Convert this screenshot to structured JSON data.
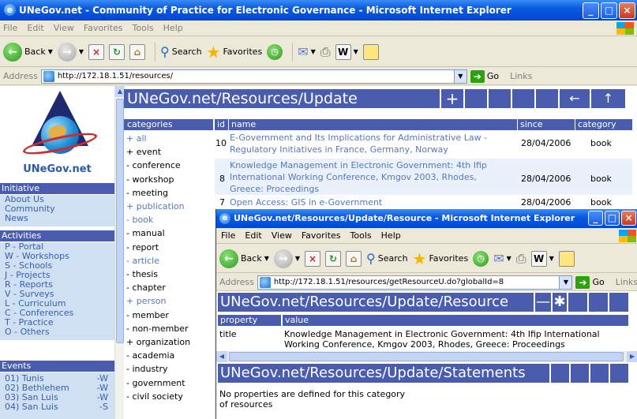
{
  "main_window": {
    "title": "UNeGov.net - Community of Practice for Electronic Governance - Microsoft Internet Explorer",
    "menu": [
      "File",
      "Edit",
      "View",
      "Favorites",
      "Tools",
      "Help"
    ],
    "toolbar": {
      "back": "Back",
      "search": "Search",
      "favorites": "Favorites"
    },
    "address_label": "Address",
    "address_url": "http://172.18.1.51/resources/",
    "go": "Go",
    "links": "Links"
  },
  "sidebar": {
    "logo_text": "UNeGov.net",
    "initiative": {
      "heading": "Initiative",
      "items": [
        "About Us",
        "Community",
        "News"
      ]
    },
    "activities": {
      "heading": "Activities",
      "items": [
        "P - Portal",
        "W - Workshops",
        "S - Schools",
        "J - Projects",
        "R - Reports",
        "V - Surveys",
        "L - Curriculum",
        "C - Conferences",
        "T - Practice",
        "O - Others"
      ]
    },
    "events": {
      "heading": "Events",
      "items": [
        {
          "label": "01) Tunis",
          "suffix": "-W"
        },
        {
          "label": "02) Bethlehem",
          "suffix": "-W"
        },
        {
          "label": "03) San Luis",
          "suffix": "-W"
        },
        {
          "label": "04) San Luis",
          "suffix": "-S"
        }
      ]
    }
  },
  "page": {
    "title": "UNeGov.net/Resources/Update",
    "plus": "+",
    "back_arrow": "←",
    "up_arrow": "↑",
    "categories_heading": "categories",
    "categories": [
      {
        "label": "+ all",
        "link": true
      },
      {
        "label": "+ event",
        "link": false
      },
      {
        "label": "- conference",
        "link": false
      },
      {
        "label": "- workshop",
        "link": false
      },
      {
        "label": "- meeting",
        "link": false
      },
      {
        "label": "+ publication",
        "link": true
      },
      {
        "label": "- book",
        "link": true
      },
      {
        "label": "- manual",
        "link": false
      },
      {
        "label": "- report",
        "link": false
      },
      {
        "label": "- article",
        "link": true
      },
      {
        "label": "- thesis",
        "link": false
      },
      {
        "label": "- chapter",
        "link": false
      },
      {
        "label": "+ person",
        "link": true
      },
      {
        "label": "- member",
        "link": false
      },
      {
        "label": "- non-member",
        "link": false
      },
      {
        "label": "+ organization",
        "link": false
      },
      {
        "label": "- academia",
        "link": false
      },
      {
        "label": "- industry",
        "link": false
      },
      {
        "label": "- government",
        "link": false
      },
      {
        "label": "- civil society",
        "link": false
      }
    ],
    "table": {
      "headers": {
        "id": "id",
        "name": "name",
        "since": "since",
        "category": "category"
      },
      "rows": [
        {
          "id": "10",
          "name_lines": [
            "E-Government and Its Implications for Administrative Law -",
            "Regulatory Initiatives in France, Germany, Norway"
          ],
          "since": "28/04/2006",
          "category": "book"
        },
        {
          "id": "8",
          "name_lines": [
            "Knowledge Management in Electronic Government: 4th Ifip",
            "International Working Conference, Kmgov 2003, Rhodes,",
            "Greece: Proceedings"
          ],
          "since": "28/04/2006",
          "category": "book"
        },
        {
          "id": "7",
          "name_lines": [
            "Open Access: GIS in e-Government"
          ],
          "since": "28/04/2006",
          "category": "book"
        }
      ]
    }
  },
  "popup": {
    "title": "UNeGov.net/Resources/Update/Resource - Microsoft Internet Explorer",
    "menu": [
      "File",
      "Edit",
      "View",
      "Favorites",
      "Tools",
      "Help"
    ],
    "toolbar": {
      "back": "Back",
      "search": "Search",
      "favorites": "Favorites"
    },
    "address_label": "Address",
    "address_url": "http://172.18.1.51/resources/getResourceU.do?globalId=8",
    "go": "Go",
    "links": "Links",
    "resource_header": "UNeGov.net/Resources/Update/Resource",
    "minus": "—",
    "asterisk": "✱",
    "property_heading": "property",
    "value_heading": "value",
    "prop_title": "title",
    "value_lines": [
      "Knowledge Management in Electronic Government: 4th Ifip International",
      "Working Conference, Kmgov 2003, Rhodes, Greece: Proceedings"
    ],
    "statements_header": "UNeGov.net/Resources/Update/Statements",
    "no_props_lines": [
      "No properties are defined for this category",
      "of resources"
    ]
  }
}
